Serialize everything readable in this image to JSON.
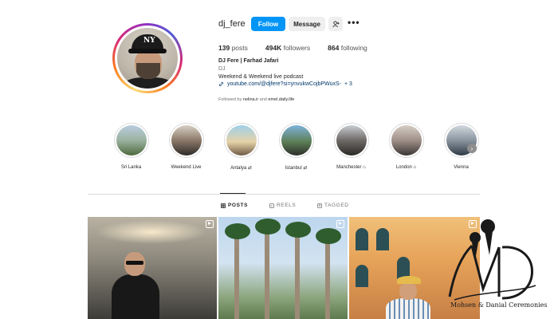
{
  "profile": {
    "username": "dj_fere",
    "follow_label": "Follow",
    "message_label": "Message",
    "add_user_icon": "add-user-icon",
    "more_label": "•••"
  },
  "stats": {
    "posts_count": "139",
    "posts_label": "posts",
    "followers_count": "494K",
    "followers_label": "followers",
    "following_count": "864",
    "following_label": "following"
  },
  "bio": {
    "name": "DJ Fere | Farhad Jafari",
    "category": "DJ",
    "description": "Weekend & Weekend live podcast",
    "link_text": "youtube.com/@djfere?si=ynvukwCojbPWuxS-",
    "link_more": "+ 3",
    "followed_by_prefix": "Followed by",
    "followed_by_user1": "nelina.ir",
    "followed_by_and": "and",
    "followed_by_user2": "emel.daily.life"
  },
  "highlights": [
    {
      "label": "Sri Lanka"
    },
    {
      "label": "Weekend Live"
    },
    {
      "label": "Antalya ⇄"
    },
    {
      "label": "Istanbul ⇄"
    },
    {
      "label": "Manchester ⌂"
    },
    {
      "label": "London ⌂"
    },
    {
      "label": "Vienna"
    }
  ],
  "tabs": {
    "posts": "POSTS",
    "reels": "REELS",
    "tagged": "TAGGED"
  },
  "watermark": {
    "text": "Mohsen & Danial Ceremonies",
    "monogram": "MD"
  }
}
